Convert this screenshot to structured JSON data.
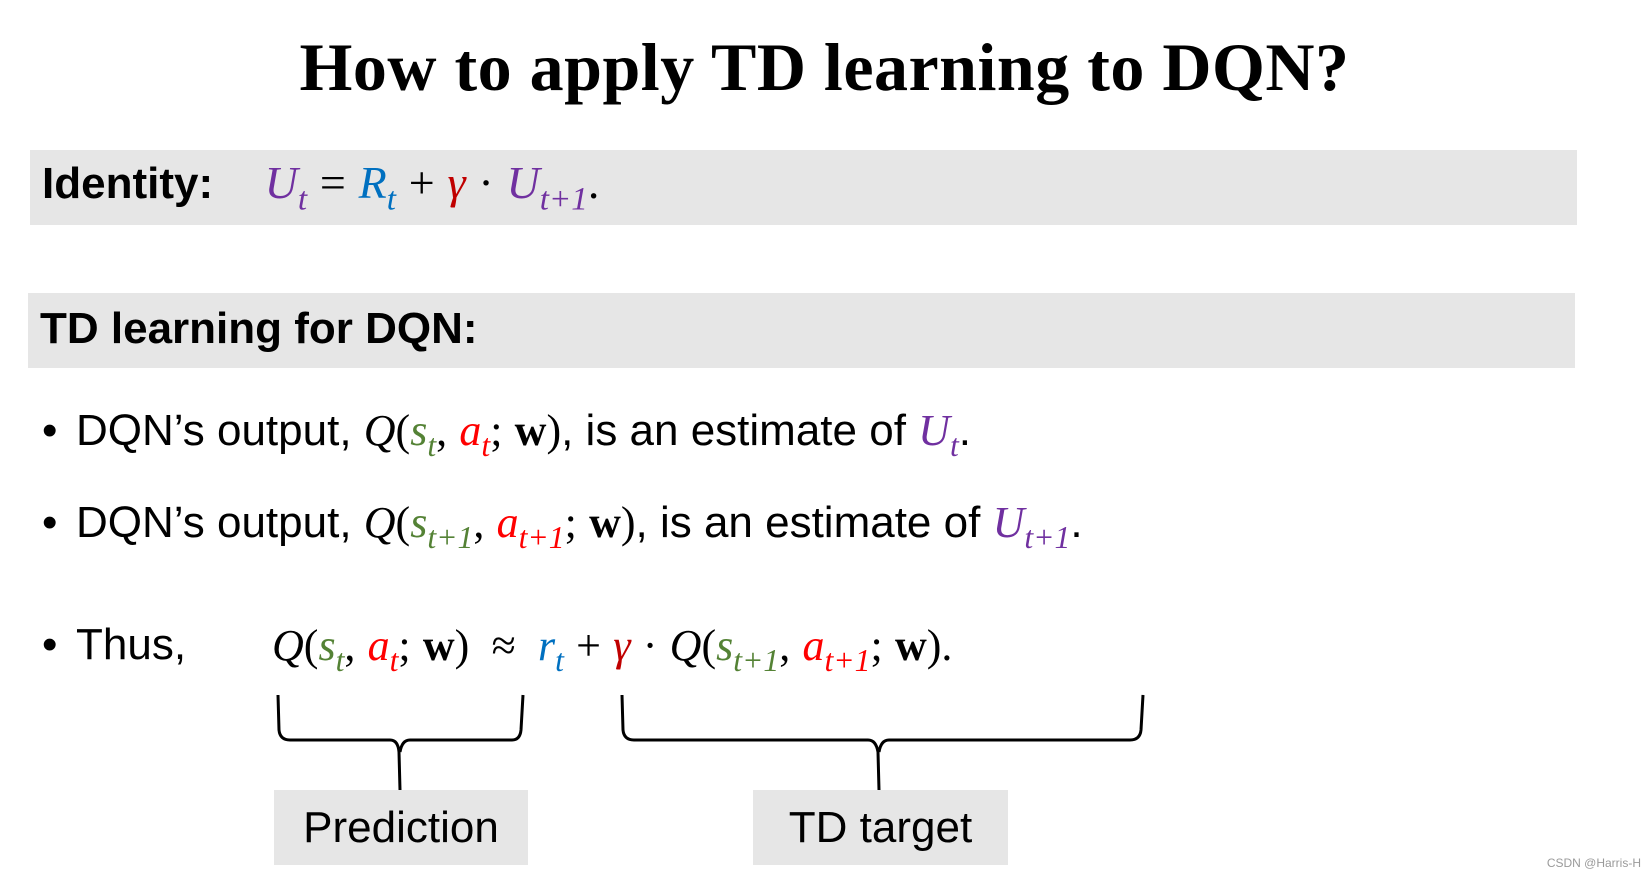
{
  "title": "How to apply TD learning to DQN?",
  "identity": {
    "label": "Identity:",
    "formula": {
      "lhs": "U",
      "lhs_sub": "t",
      "eq": "=",
      "r": "R",
      "r_sub": "t",
      "plus": "+",
      "gamma": "γ",
      "dot": "·",
      "u_next": "U",
      "u_next_sub": "t+1",
      "end": "."
    }
  },
  "section": {
    "heading": "TD learning for DQN:"
  },
  "bullets": [
    {
      "prefix": "DQN’s output, ",
      "q": "Q",
      "open": "(",
      "s": "s",
      "s_sub": "t",
      "comma": ",",
      "a": "a",
      "a_sub": "t",
      "semi": ";",
      "w": "w",
      "close": ")",
      "suffix": ", is an estimate of ",
      "u": "U",
      "u_sub": "t",
      "end": "."
    },
    {
      "prefix": "DQN’s output, ",
      "q": "Q",
      "open": "(",
      "s": "s",
      "s_sub": "t+1",
      "comma": ",",
      "a": "a",
      "a_sub": "t+1",
      "semi": ";",
      "w": "w",
      "close": ")",
      "suffix": ", is an estimate of ",
      "u": "U",
      "u_sub": "t+1",
      "end": "."
    }
  ],
  "thus": {
    "label": "Thus,",
    "lhs": {
      "q": "Q",
      "open": "(",
      "s": "s",
      "s_sub": "t",
      "comma": ",",
      "a": "a",
      "a_sub": "t",
      "semi": ";",
      "w": "w",
      "close": ")"
    },
    "approx": "≈",
    "rhs": {
      "r": "r",
      "r_sub": "t",
      "plus": "+",
      "gamma": "γ",
      "dot": "·",
      "q": "Q",
      "open": "(",
      "s": "s",
      "s_sub": "t+1",
      "comma": ",",
      "a": "a",
      "a_sub": "t+1",
      "semi": ";",
      "w": "w",
      "close": ")",
      "end": "."
    }
  },
  "annotations": {
    "prediction": "Prediction",
    "td_target": "TD target"
  },
  "watermark": "CSDN @Harris-H",
  "colors": {
    "utility": "#7030a0",
    "reward": "#0070c0",
    "gamma": "#c00000",
    "action": "#ff0000",
    "state": "#548235",
    "band": "#e6e6e6"
  }
}
